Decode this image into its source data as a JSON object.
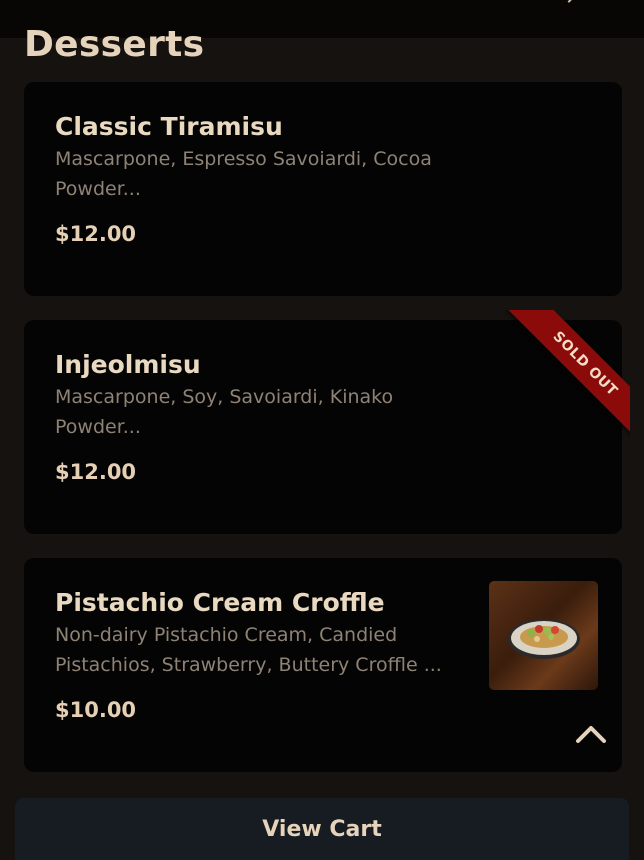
{
  "section": {
    "title": "Desserts"
  },
  "items": [
    {
      "name": "Classic Tiramisu",
      "description": "Mascarpone, Espresso Savoiardi, Cocoa Powder...",
      "price": "$12.00"
    },
    {
      "name": "Injeolmisu",
      "description": "Mascarpone, Soy, Savoiardi, Kinako Powder...",
      "price": "$12.00",
      "badge": "SOLD OUT"
    },
    {
      "name": "Pistachio Cream Croffle",
      "description": "Non-dairy Pistachio Cream, Candied Pistachios, Strawberry, Buttery Croffle ...",
      "price": "$10.00"
    }
  ],
  "cart": {
    "label": "View Cart"
  },
  "colors": {
    "background": "#15120f",
    "card": "#050404",
    "sold_out_ribbon": "#8b0a0a",
    "cart_button": "#171b22"
  },
  "icons": {
    "top_chevron": "chevron-down-icon",
    "scroll_top": "chevron-up-icon"
  }
}
